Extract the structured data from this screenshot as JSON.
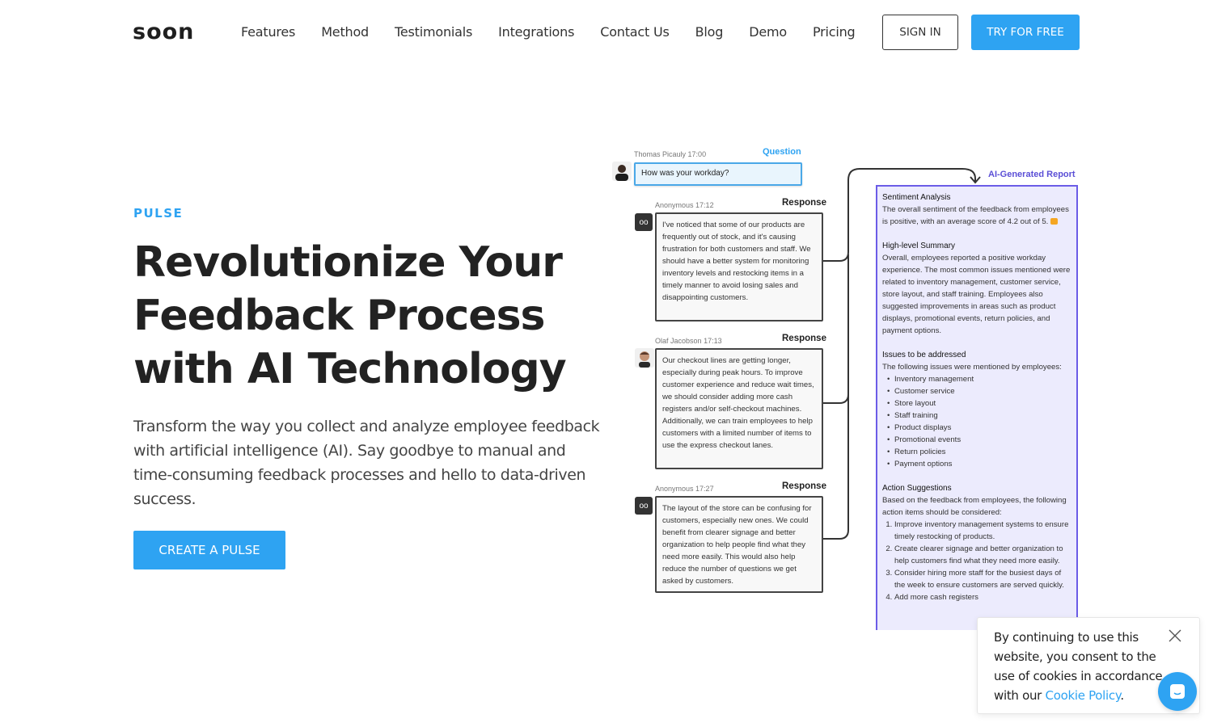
{
  "nav": {
    "logo": "soon",
    "links": [
      "Features",
      "Method",
      "Testimonials",
      "Integrations",
      "Contact Us",
      "Blog",
      "Demo",
      "Pricing"
    ],
    "sign_in": "SIGN IN",
    "try_free": "TRY FOR FREE"
  },
  "hero": {
    "eyebrow": "PULSE",
    "headline_lines": [
      "Revolutionize Your",
      "Feedback Process",
      "with AI Technology"
    ],
    "subhead": "Transform the way you collect and analyze employee feedback with artificial intelligence (AI). Say goodbye to manual and time-consuming feedback processes and hello to data-driven success.",
    "cta": "CREATE A PULSE"
  },
  "illustration": {
    "question": {
      "author": "Thomas Picauly",
      "time": "17:00",
      "tag": "Question",
      "text": "How was your workday?"
    },
    "responses": [
      {
        "author": "Anonymous",
        "time": "17:12",
        "tag": "Response",
        "avatar": "anonymous-glasses-icon",
        "text": "I've noticed that some of our products are frequently out of stock, and it's causing frustration for both customers and staff. We should have a better system for monitoring inventory levels and restocking items in a timely manner to avoid losing sales and disappointing customers."
      },
      {
        "author": "Olaf Jacobson",
        "time": "17:13",
        "tag": "Response",
        "avatar": "user-photo",
        "text": "Our checkout lines are getting longer, especially during peak hours. To improve customer experience and reduce wait times, we should consider adding more cash registers and/or self-checkout machines. Additionally, we can train employees to help customers with a limited number of items to use the express checkout lanes."
      },
      {
        "author": "Anonymous",
        "time": "17:27",
        "tag": "Response",
        "avatar": "anonymous-glasses-icon",
        "text": "The layout of the store can be confusing for customers, especially new ones. We could benefit from clearer signage and better organization to help people find what they need more easily. This would also help reduce the number of questions we get asked by customers."
      }
    ],
    "report": {
      "label": "AI-Generated Report",
      "sentiment_title": "Sentiment Analysis",
      "sentiment_text": "The overall sentiment of the feedback from employees is positive, with an average score of 4.2 out of 5.",
      "summary_title": "High-level Summary",
      "summary_text": "Overall, employees reported a positive workday experience. The most common issues mentioned were related to inventory management, customer service, store layout, and staff training. Employees also suggested improvements in areas such as product displays, promotional events, return policies, and payment options.",
      "issues_title": "Issues to be addressed",
      "issues_intro": "The following issues were mentioned by employees:",
      "issues": [
        "Inventory management",
        "Customer service",
        "Store layout",
        "Staff training",
        "Product displays",
        "Promotional events",
        "Return policies",
        "Payment options"
      ],
      "actions_title": "Action Suggestions",
      "actions_intro": "Based on the feedback from employees, the following action items should be considered:",
      "actions": [
        "Improve inventory management systems to ensure timely restocking of products.",
        "Create clearer signage and better organization to help customers find what they need more easily.",
        "Consider hiring more staff for the busiest days of the week to ensure customers are served quickly.",
        "Add more cash registers"
      ]
    }
  },
  "cookie": {
    "text": "By continuing to use this website, you consent to the use of cookies in accordance with our ",
    "link": "Cookie Policy",
    "suffix": "."
  },
  "colors": {
    "accent": "#2ea3f2",
    "report_border": "#6b5ce7",
    "report_bg": "#ecebfd"
  }
}
